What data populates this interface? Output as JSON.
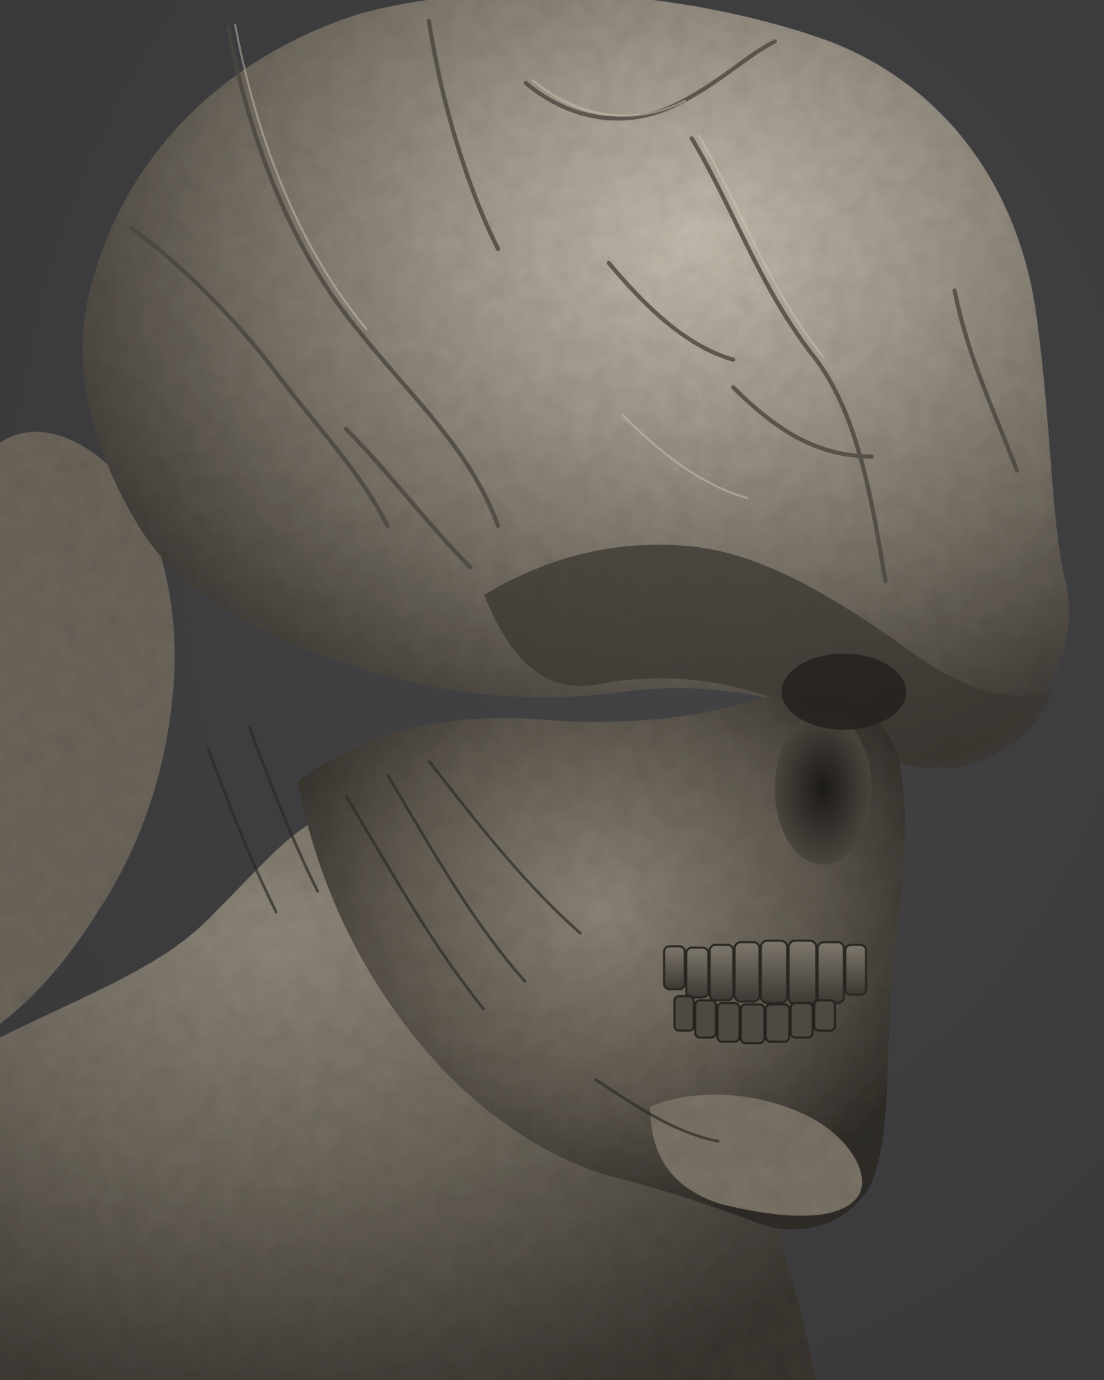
{
  "scene": {
    "subject": "",
    "background_color": "#3d3d3f",
    "material_base_color": "#8a8478",
    "material_shadow_color": "#2e2b27",
    "material_highlight_color": "#c9c2b4"
  }
}
